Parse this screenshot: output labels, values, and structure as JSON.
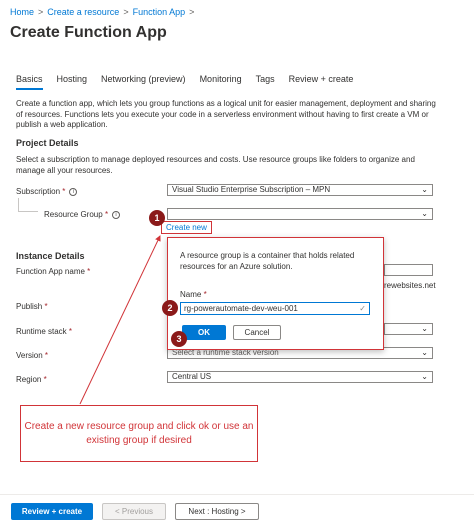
{
  "breadcrumb": [
    "Home",
    "Create a resource",
    "Function App"
  ],
  "page_title": "Create Function App",
  "tabs": [
    {
      "label": "Basics",
      "active": true
    },
    {
      "label": "Hosting"
    },
    {
      "label": "Networking (preview)"
    },
    {
      "label": "Monitoring"
    },
    {
      "label": "Tags"
    },
    {
      "label": "Review + create"
    }
  ],
  "intro": "Create a function app, which lets you group functions as a logical unit for easier management, deployment and sharing of resources. Functions lets you execute your code in a serverless environment without having to first create a VM or publish a web application.",
  "project": {
    "heading": "Project Details",
    "desc": "Select a subscription to manage deployed resources and costs. Use resource groups like folders to organize and manage all your resources.",
    "subscription_label": "Subscription",
    "subscription_value": "Visual Studio Enterprise Subscription – MPN",
    "resource_group_label": "Resource Group",
    "create_new": "Create new"
  },
  "instance": {
    "heading": "Instance Details",
    "function_app_name_label": "Function App name",
    "domain_suffix": "rewebsites.net",
    "publish_label": "Publish",
    "runtime_label": "Runtime stack",
    "version_label": "Version",
    "version_placeholder": "Select a runtime stack version",
    "region_label": "Region",
    "region_value": "Central US"
  },
  "required_mark": "*",
  "info_glyph": "i",
  "breadcrumb_sep": ">",
  "popup": {
    "text": "A resource group is a container that holds related resources for an Azure solution.",
    "name_label": "Name",
    "name_value": "rg-powerautomate-dev-weu-001",
    "ok": "OK",
    "cancel": "Cancel"
  },
  "markers": [
    "1",
    "2",
    "3"
  ],
  "callout": "Create a new resource group and click ok or use an existing group if desired",
  "footer": {
    "review": "Review + create",
    "previous": "< Previous",
    "next": "Next : Hosting >"
  },
  "colors": {
    "accent": "#0078d4",
    "annotation": "#d13438",
    "marker": "#8b1a1a"
  }
}
